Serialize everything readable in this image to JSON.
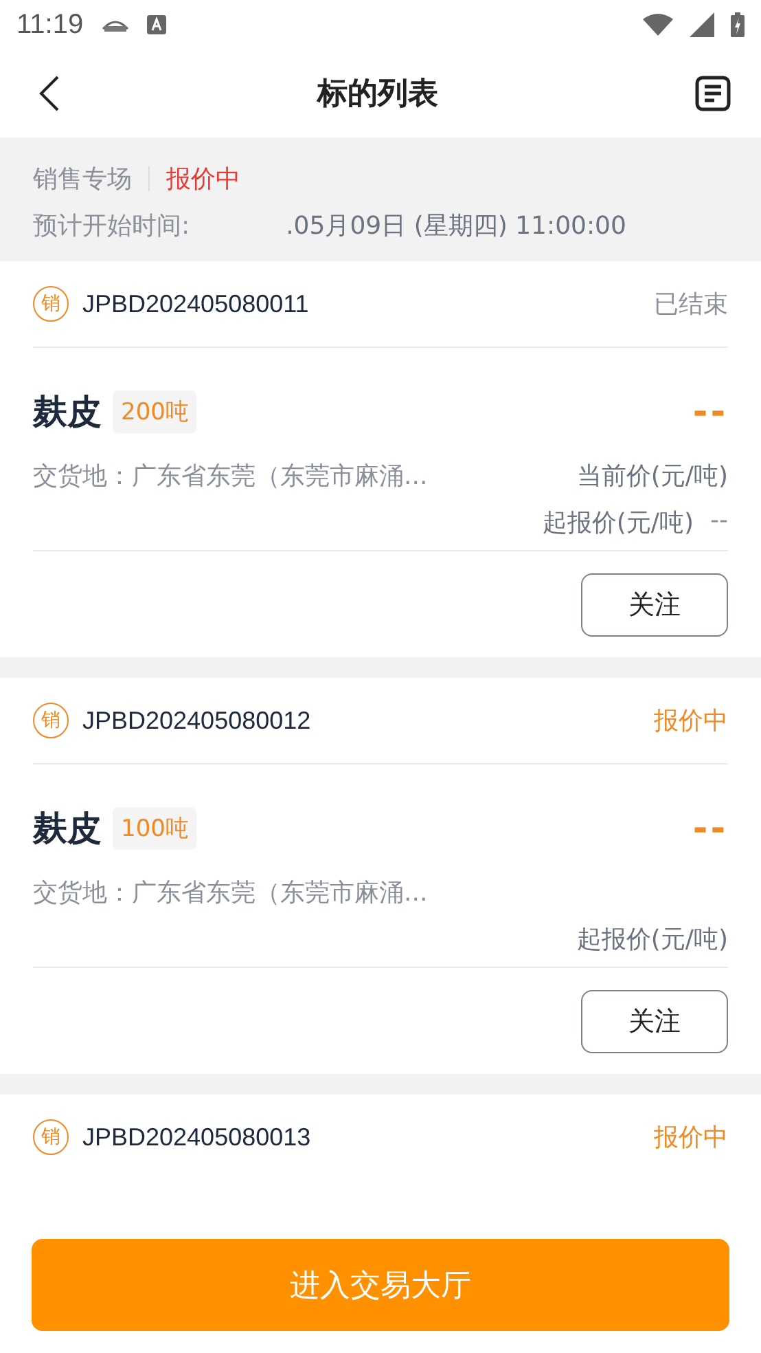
{
  "status_bar": {
    "time": "11:19"
  },
  "header": {
    "title": "标的列表"
  },
  "session": {
    "name": "销售专场",
    "status": "报价中",
    "start_label": "预计开始时间:",
    "start_time": ".05月09日 (星期四) 11:00:00"
  },
  "lots": [
    {
      "badge": "销",
      "code": "JPBD202405080011",
      "status": "已结束",
      "kind": "ended",
      "name": "麸皮",
      "quantity": "200吨",
      "price": "--",
      "location": "交货地：广东省东莞（东莞市麻涌...",
      "current_price_label": "当前价(元/吨)",
      "start_price_label": "起报价(元/吨)",
      "start_price": "--",
      "follow_button": "关注"
    },
    {
      "badge": "销",
      "code": "JPBD202405080012",
      "status": "报价中",
      "kind": "quoting",
      "name": "麸皮",
      "quantity": "100吨",
      "price": "--",
      "location": "交货地：广东省东莞（东莞市麻涌...",
      "start_price_label": "起报价(元/吨)",
      "follow_button": "关注"
    },
    {
      "badge": "销",
      "code": "JPBD202405080013",
      "status": "报价中",
      "kind": "quoting"
    }
  ],
  "enter_button": "进入交易大厅"
}
